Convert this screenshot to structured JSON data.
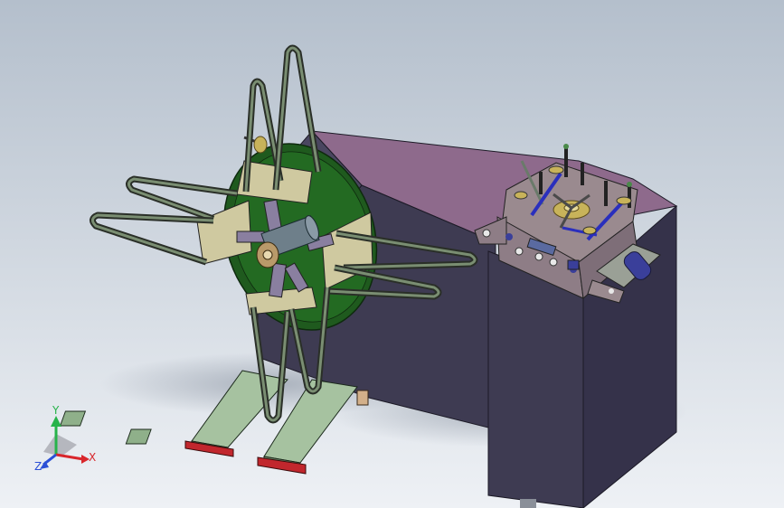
{
  "viewport": {
    "background_top": "#b4bfcc",
    "background_bottom": "#eef1f5"
  },
  "triad": {
    "x_label": "X",
    "y_label": "Y",
    "z_label": "Z",
    "x_color": "#d9262b",
    "y_color": "#27b34a",
    "z_color": "#2b4fd6"
  },
  "colors": {
    "housing_top": "#8e6a8c",
    "housing_side": "#3e3b52",
    "housing_dark": "#2f2c40",
    "reel_disc": "#1f5a1e",
    "reel_ring": "#2e7a2c",
    "frame_green": "#8fb08a",
    "base_green": "#a6c2a0",
    "base_pad": "#c1272d",
    "arm_wire": "#4c5a45",
    "brass": "#c8b35a",
    "steel": "#6e6f7d",
    "lever_blue": "#2a2fbd"
  }
}
